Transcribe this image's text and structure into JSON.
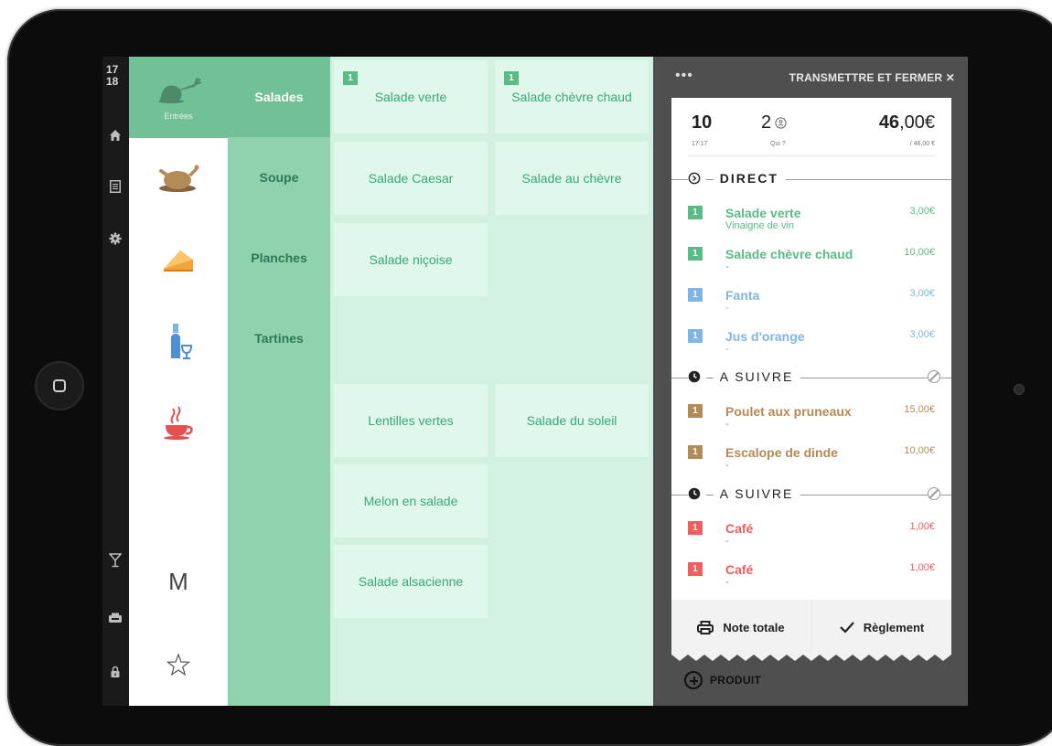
{
  "status": {
    "time_hour": "17",
    "time_min": "18"
  },
  "categories": [
    {
      "icon": "carrot-icon",
      "label": "Entrées",
      "active": true
    },
    {
      "icon": "roast-chicken-icon",
      "label": "",
      "active": false
    },
    {
      "icon": "pie-slice-icon",
      "label": "",
      "active": false
    },
    {
      "icon": "wine-bottle-icon",
      "label": "",
      "active": false
    },
    {
      "icon": "hot-cup-icon",
      "label": "",
      "active": false
    }
  ],
  "bottom_categories": {
    "menu_letter": "M",
    "favorites_icon": "star-icon"
  },
  "subcategories": [
    "Salades",
    "Soupe",
    "Planches",
    "Tartines"
  ],
  "products": [
    {
      "name": "Salade verte",
      "qty": "1"
    },
    {
      "name": "Salade chèvre chaud",
      "qty": "1"
    },
    {
      "name": "Salade Caesar",
      "qty": ""
    },
    {
      "name": "Salade au chèvre",
      "qty": ""
    },
    {
      "name": "Salade niçoise",
      "qty": ""
    },
    {
      "name": "Lentilles vertes",
      "qty": ""
    },
    {
      "name": "Salade du soleil",
      "qty": ""
    },
    {
      "name": "Melon en salade",
      "qty": ""
    },
    {
      "name": "Salade alsacienne",
      "qty": ""
    }
  ],
  "order": {
    "menu_dots": "•••",
    "close_label": "TRANSMETTRE ET FERMER ✕",
    "table": "10",
    "table_time": "17:17",
    "covers": "2",
    "covers_label": "Qui ?",
    "total_int": "46",
    "total_dec": ",00€",
    "total_sub": "/ 46,00 €",
    "sections": [
      {
        "title": "DIRECT",
        "items": [
          {
            "qty": "1",
            "name": "Salade verte",
            "note": "Vinaigne de vin",
            "price": "3,00€",
            "color": "#59bb86"
          },
          {
            "qty": "1",
            "name": "Salade chèvre chaud",
            "note": "-",
            "price": "10,00€",
            "color": "#59bb86"
          },
          {
            "qty": "1",
            "name": "Fanta",
            "note": "-",
            "price": "3,00€",
            "color": "#7db5e6"
          },
          {
            "qty": "1",
            "name": "Jus d'orange",
            "note": "-",
            "price": "3,00€",
            "color": "#7db5e6"
          }
        ]
      },
      {
        "title": "A SUIVRE",
        "items": [
          {
            "qty": "1",
            "name": "Poulet aux pruneaux",
            "note": "-",
            "price": "15,00€",
            "color": "#b38b56"
          },
          {
            "qty": "1",
            "name": "Escalope de dinde",
            "note": "-",
            "price": "10,00€",
            "color": "#b38b56"
          }
        ]
      },
      {
        "title": "A SUIVRE",
        "items": [
          {
            "qty": "1",
            "name": "Café",
            "note": "-",
            "price": "1,00€",
            "color": "#ef5d5d"
          },
          {
            "qty": "1",
            "name": "Café",
            "note": "-",
            "price": "1,00€",
            "color": "#ef5d5d"
          }
        ]
      }
    ],
    "note_totale": "Note totale",
    "reglement": "Règlement",
    "add_product": "PRODUIT"
  }
}
